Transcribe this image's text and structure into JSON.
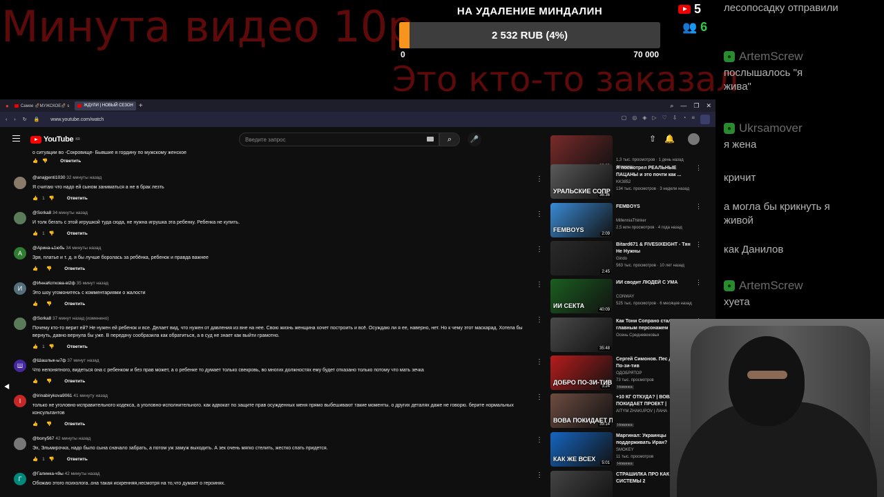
{
  "overlay": {
    "top_text": "Минута видео 10р",
    "mid_text": "Это кто-то заказал",
    "goal": {
      "title": "НА УДАЛЕНИЕ МИНДАЛИН",
      "amount": "2 532 RUB (4%)",
      "progress_percent": 4,
      "min": "0",
      "max": "70 000",
      "bar_color": "#f7941d"
    },
    "youtube_count": "5",
    "viewers_count": "6",
    "viewers_color": "#2ecc40"
  },
  "chat": [
    {
      "author": "",
      "message": "лесопосадку отправили"
    },
    {
      "author": "ArtemScrew",
      "message": "послышалось \"я жива\""
    },
    {
      "author": "Ukrsamover",
      "message": "я жена"
    },
    {
      "author": "",
      "message": "кричит"
    },
    {
      "author": "",
      "message": "а могла бы крикнуть я живой"
    },
    {
      "author": "",
      "message": "как Данилов"
    },
    {
      "author": "ArtemScrew",
      "message": "хуета"
    }
  ],
  "browser": {
    "tabs": [
      {
        "label": "Самое 💣МУЖСКОЕ💣 s"
      },
      {
        "label": "ЖДУЛИ | НОВЫЙ СЕЗОН"
      }
    ],
    "url": "www.youtube.com/watch"
  },
  "youtube": {
    "logo": "YouTube",
    "logo_region": "KR",
    "search_placeholder": "Введите запрос"
  },
  "top_partial_comment": "о ситуации во -Сокровище- Бывшие я гордину по мужскому женское",
  "comments": [
    {
      "user": "@anajgenti1030",
      "time": "32 минуты назад",
      "text": "Я считаю что надо ей сыном заниматься а не в брак лезть",
      "likes": "1",
      "reply": "Ответить",
      "avatar_letter": "",
      "avatar_color": "#8a7a6a"
    },
    {
      "user": "@Sorka8",
      "time": "34 минуты назад",
      "text": "И толк бегать с этой игрушкой туда сюда, не нужна игрушка эта ребенку. Ребенка не купить.",
      "likes": "1",
      "reply": "Ответить",
      "avatar_letter": "",
      "avatar_color": "#5a7a5a"
    },
    {
      "user": "@Арина-ь1юбь",
      "time": "34 минуты назад",
      "text": "Зря, платье и т. д. я бы лучше боролась за ребёнка, ребенок и правда важнее",
      "likes": "",
      "reply": "Ответить",
      "avatar_letter": "А",
      "avatar_color": "#2e7d32"
    },
    {
      "user": "@ИннаКоткова-ві2ф",
      "time": "35 минут назад",
      "text": "Это шоу угомонитесь с комментариями о жалости",
      "likes": "",
      "reply": "Ответить",
      "avatar_letter": "И",
      "avatar_color": "#546e7a"
    },
    {
      "user": "@Sorka8",
      "time": "37 минут назад (изменено)",
      "text": "Почему кто-то верит ей? Не нужен ей ребенок и все. Делает вид, что нужен от давления из вне на нее. Свою жизнь женщина хочет построить и всё. Осуждаю ли я ее, наверно, нет. Но к чему этот маскарад. Хотела бы вернуть, давно вернула бы уже. В передачу сообразила как обратиться, а в суд не знает как выйти грамотно.",
      "likes": "1",
      "reply": "Ответить",
      "avatar_letter": "",
      "avatar_color": "#5a7a5a"
    },
    {
      "user": "@Шашлык-ы7ф",
      "time": "37 минут назад",
      "text": "Что непонятного, видеться она с ребенком и без прав может, а о ребенке то думает только свекровь, во многих должностях ему будет отказано только потому что мать зечка",
      "likes": "",
      "reply": "Ответить",
      "avatar_letter": "Ш",
      "avatar_color": "#4527a0"
    },
    {
      "user": "@irinabirykova9061",
      "time": "41 минуту назад",
      "text": "только не уголовно-исправительного кодекса, а уголовно-исполнительного. как адвокат по защите прав осужденных меня прямо выбешивают такие моменты. о других  деталях даже не говорю. берите нормальных консультантов",
      "likes": "",
      "reply": "Ответить",
      "avatar_letter": "I",
      "avatar_color": "#c62828"
    },
    {
      "user": "@bony567",
      "time": "42 минуты назад",
      "text": "Эх, Эльмирочка, надо было сына сначало забрать, а потом уж замуж выходить. А зек очень мягко стелить, жестко спать придется.",
      "likes": "1",
      "reply": "Ответить",
      "avatar_letter": "",
      "avatar_color": "#777777"
    },
    {
      "user": "@Галинка-ч9ы",
      "time": "42 минуты назад",
      "text": "Обожаю этого психолога..она такая искренняя,несмотря на то,что думает о героинях.",
      "likes": "",
      "reply": "",
      "avatar_letter": "Г",
      "avatar_color": "#00897b"
    }
  ],
  "recommendations": [
    {
      "title": "",
      "channel": "",
      "stats": "1,3 тыс. просмотров · 1 день назад",
      "badge": "Новинка",
      "duration": "23:33",
      "thumb_text": "",
      "thumb_color": "#7a2a2a"
    },
    {
      "title": "Я посмотрел РЕАЛЬНЫЕ ПАЦАНЫ и это почти как ...",
      "channel": "KK3852",
      "stats": "134 тыс. просмотров · 3 недели назад",
      "badge": "",
      "duration": "36:36",
      "thumb_text": "УРАЛЬСКИЕ СОПР",
      "thumb_color": "#5a5a5a"
    },
    {
      "title": "FEMBOYS",
      "channel": "MillenniaThinker",
      "stats": "2,5 млн просмотров · 4 года назад",
      "badge": "",
      "duration": "2:09",
      "thumb_text": "FEMBOYS",
      "thumb_color": "#3a8ad4"
    },
    {
      "title": "Bitard671 & FIVESIXEIGHT - Тян Не Нужны",
      "channel": "Gindo",
      "stats": "563 тыс. просмотров · 10 лет назад",
      "badge": "",
      "duration": "2:45",
      "thumb_text": "",
      "thumb_color": "#2a2a2a"
    },
    {
      "title": "ИИ сводит ЛЮДЕЙ С УМА",
      "channel": "CONWAY",
      "stats": "525 тыс. просмотров · 6 месяцев назад",
      "badge": "",
      "duration": "40:09",
      "thumb_text": "ИИ СЕКТА",
      "thumb_color": "#1b5e20"
    },
    {
      "title": "Как Тони Сопрано стал главным персонажем",
      "channel": "Осень Средневековья",
      "stats": "",
      "badge": "",
      "duration": "35:48",
      "thumb_text": "",
      "thumb_color": "#4a4a4a"
    },
    {
      "title": "Сергей Симонов. Пес Добро По-зи-тив",
      "channel": "ОДОБРЯТОР",
      "stats": "73 тыс. просмотров",
      "badge": "Новинка",
      "duration": "3:24",
      "thumb_text": "ДОБРО ПО-ЗИ-ТИВ",
      "thumb_color": "#b71c1c"
    },
    {
      "title": "+10 КГ ОТКУДА? | ВОВА ПОКИДАЕТ ПРОЕКТ |",
      "channel": "AITYM ZHAKUPOV | ЛАНА",
      "stats": "",
      "badge": "Новинка",
      "duration": "39:14",
      "thumb_text": "ВОВА ПОКИДАЕТ ПРОЕ",
      "thumb_color": "#6d4c41"
    },
    {
      "title": "Маргинал: Украинцы поддерживать Иран?",
      "channel": "SMOKEY",
      "stats": "11 тыс. просмотров",
      "badge": "Новинка",
      "duration": "5:01",
      "thumb_text": "КАК ЖЕ ВСЕХ",
      "thumb_color": "#1565c0"
    },
    {
      "title": "СТРАШИЛКА ПРО КАК РАБА СИСТЕМЫ 2",
      "channel": "",
      "stats": "",
      "badge": "",
      "duration": "",
      "thumb_text": "",
      "thumb_color": "#444444"
    }
  ]
}
